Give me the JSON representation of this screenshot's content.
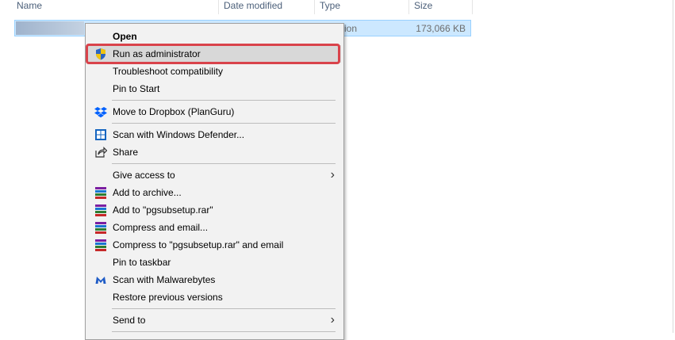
{
  "columns": {
    "name": "Name",
    "date_modified": "Date modified",
    "type": "Type",
    "size": "Size"
  },
  "file": {
    "type_fragment": "ation",
    "size": "173,066 KB"
  },
  "menu": {
    "open": "Open",
    "run_as_admin": "Run as administrator",
    "troubleshoot": "Troubleshoot compatibility",
    "pin_start": "Pin to Start",
    "dropbox": "Move to Dropbox (PlanGuru)",
    "defender": "Scan with Windows Defender...",
    "share": "Share",
    "give_access": "Give access to",
    "add_archive": "Add to archive...",
    "add_rar": "Add to \"pgsubsetup.rar\"",
    "compress_email": "Compress and email...",
    "compress_rar_email": "Compress to \"pgsubsetup.rar\" and email",
    "pin_taskbar": "Pin to taskbar",
    "malwarebytes": "Scan with Malwarebytes",
    "restore": "Restore previous versions",
    "send_to": "Send to"
  },
  "icons": {
    "shield": "uac-shield-icon",
    "dropbox": "dropbox-icon",
    "defender": "windows-defender-icon",
    "share": "share-icon",
    "winrar": "winrar-icon",
    "malwarebytes": "malwarebytes-icon",
    "submenu": "chevron-right-icon"
  },
  "colors": {
    "selection": "#cce8ff",
    "highlight_border": "#d9434b",
    "menu_bg": "#f2f2f2"
  }
}
